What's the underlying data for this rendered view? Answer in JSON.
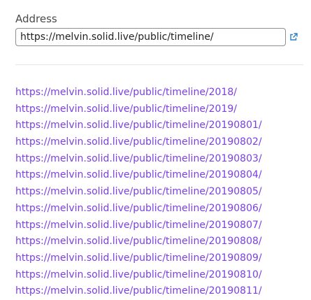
{
  "address": {
    "label": "Address",
    "value": "https://melvin.solid.live/public/timeline/"
  },
  "icons": {
    "open_link": "external-link-icon"
  },
  "colors": {
    "link": "#7b3fe4",
    "icon": "#2a7fc8"
  },
  "links": [
    "https://melvin.solid.live/public/timeline/2018/",
    "https://melvin.solid.live/public/timeline/2019/",
    "https://melvin.solid.live/public/timeline/20190801/",
    "https://melvin.solid.live/public/timeline/20190802/",
    "https://melvin.solid.live/public/timeline/20190803/",
    "https://melvin.solid.live/public/timeline/20190804/",
    "https://melvin.solid.live/public/timeline/20190805/",
    "https://melvin.solid.live/public/timeline/20190806/",
    "https://melvin.solid.live/public/timeline/20190807/",
    "https://melvin.solid.live/public/timeline/20190808/",
    "https://melvin.solid.live/public/timeline/20190809/",
    "https://melvin.solid.live/public/timeline/20190810/",
    "https://melvin.solid.live/public/timeline/20190811/"
  ]
}
